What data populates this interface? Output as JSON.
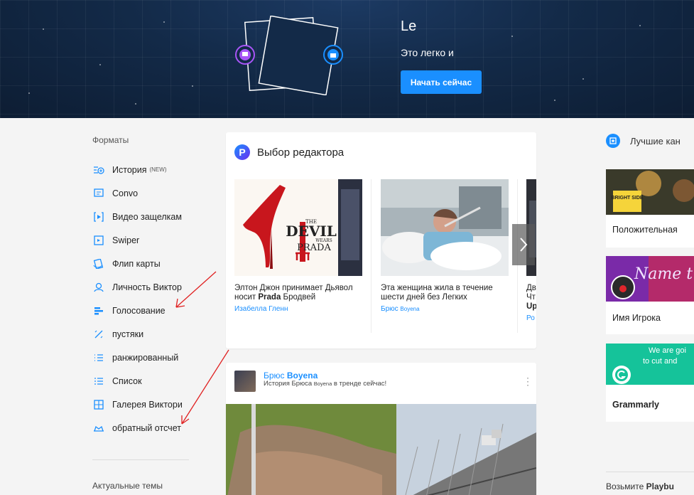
{
  "hero": {
    "title": "Le",
    "subtitle": "Это легко и",
    "cta_label": "Начать сейчас"
  },
  "sidebar": {
    "formats_title": "Форматы",
    "items": [
      {
        "label": "История",
        "badge": "(NEW)",
        "icon": "story-icon"
      },
      {
        "label": "Convo",
        "icon": "convo-icon"
      },
      {
        "label": "Видео защелкам",
        "icon": "video-snap-icon"
      },
      {
        "label": "Swiper",
        "icon": "swiper-icon"
      },
      {
        "label": "Флип карты",
        "icon": "flip-cards-icon"
      },
      {
        "label": "Личность Виктор",
        "icon": "personality-icon"
      },
      {
        "label": "Голосование",
        "icon": "poll-icon"
      },
      {
        "label": "пустяки",
        "icon": "trivia-icon"
      },
      {
        "label": "ранжированный",
        "icon": "ranked-icon"
      },
      {
        "label": "Список",
        "icon": "list-icon"
      },
      {
        "label": "Галерея Виктори",
        "icon": "gallery-icon"
      },
      {
        "label": "обратный отсчет",
        "icon": "countdown-icon"
      }
    ],
    "trending_title": "Актуальные темы"
  },
  "editor": {
    "logo_letter": "P",
    "title": "Выбор редактора",
    "articles": [
      {
        "text_before": "Элтон Джон принимает Дьявол носит ",
        "text_bold": "Prada",
        "text_after": " Бродвей",
        "author": "Изабелла Гленн",
        "author_small": ""
      },
      {
        "text_before": "Эта женщина жила в течение шести дней без Легких",
        "text_bold": "",
        "text_after": "",
        "author": "Брюс ",
        "author_small": "Boyena"
      },
      {
        "text_before": "Дв Чт ",
        "text_bold": "Up",
        "text_after": "",
        "author": "Ро",
        "author_small": ""
      }
    ],
    "poster_lines": {
      "the": "THE",
      "devil": "DEVIL",
      "wears": "WEARS",
      "prada": "PRADA"
    }
  },
  "post": {
    "author_first": "Брюс ",
    "author_bold": "Boyena",
    "desc_before": "История Брюса ",
    "desc_small": "Boyena",
    "desc_after": " в тренде сейчас!",
    "more_label": "⋮"
  },
  "right": {
    "title": "Лучшие кан",
    "channels": [
      {
        "label": "Положительная",
        "banner_text": "BRIGHT SIDE"
      },
      {
        "label": "Имя Игрока",
        "banner_text": "Name t"
      },
      {
        "label": "Grammarly",
        "banner_text_1": "We are goi",
        "banner_text_2": "to cut and"
      }
    ],
    "bottom_text_before": "Возьмите ",
    "bottom_text_bold": "Playbu"
  },
  "colors": {
    "accent": "#1a8fff",
    "hero_bg": "#132a48",
    "annotation": "#e02020"
  }
}
